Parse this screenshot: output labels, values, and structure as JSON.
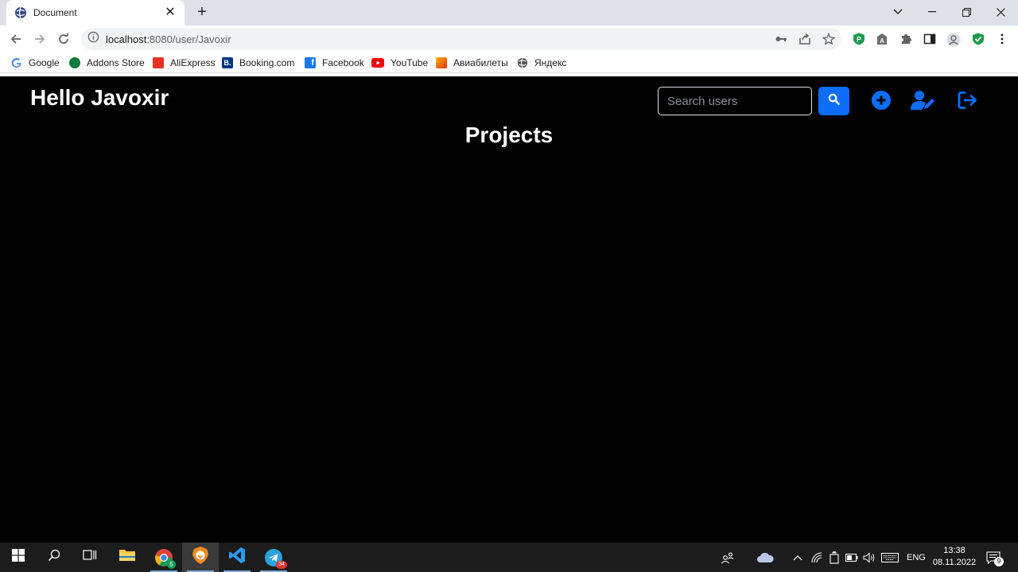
{
  "browser": {
    "tab_title": "Document",
    "url_host": "localhost",
    "url_path": ":8080/user/Javoxir",
    "bookmarks": [
      {
        "label": "Google",
        "color": "#4285f4"
      },
      {
        "label": "Addons Store",
        "color": "#0f7b3a"
      },
      {
        "label": "AliExpress",
        "color": "#e43225"
      },
      {
        "label": "Booking.com",
        "color": "#003580"
      },
      {
        "label": "Facebook",
        "color": "#1877f2"
      },
      {
        "label": "YouTube",
        "color": "#ff0000"
      },
      {
        "label": "Авиабилеты",
        "color": "#ff6a00"
      },
      {
        "label": "Яндекс",
        "color": "#555555"
      }
    ]
  },
  "page": {
    "greeting": "Hello Javoxir",
    "search_placeholder": "Search users",
    "projects_title": "Projects",
    "accent_color": "#0d6efd"
  },
  "taskbar": {
    "language": "ENG",
    "time": "13:38",
    "date": "08.11.2022",
    "notification_count": "9",
    "telegram_badge": "34",
    "chrome_badge": "5"
  }
}
